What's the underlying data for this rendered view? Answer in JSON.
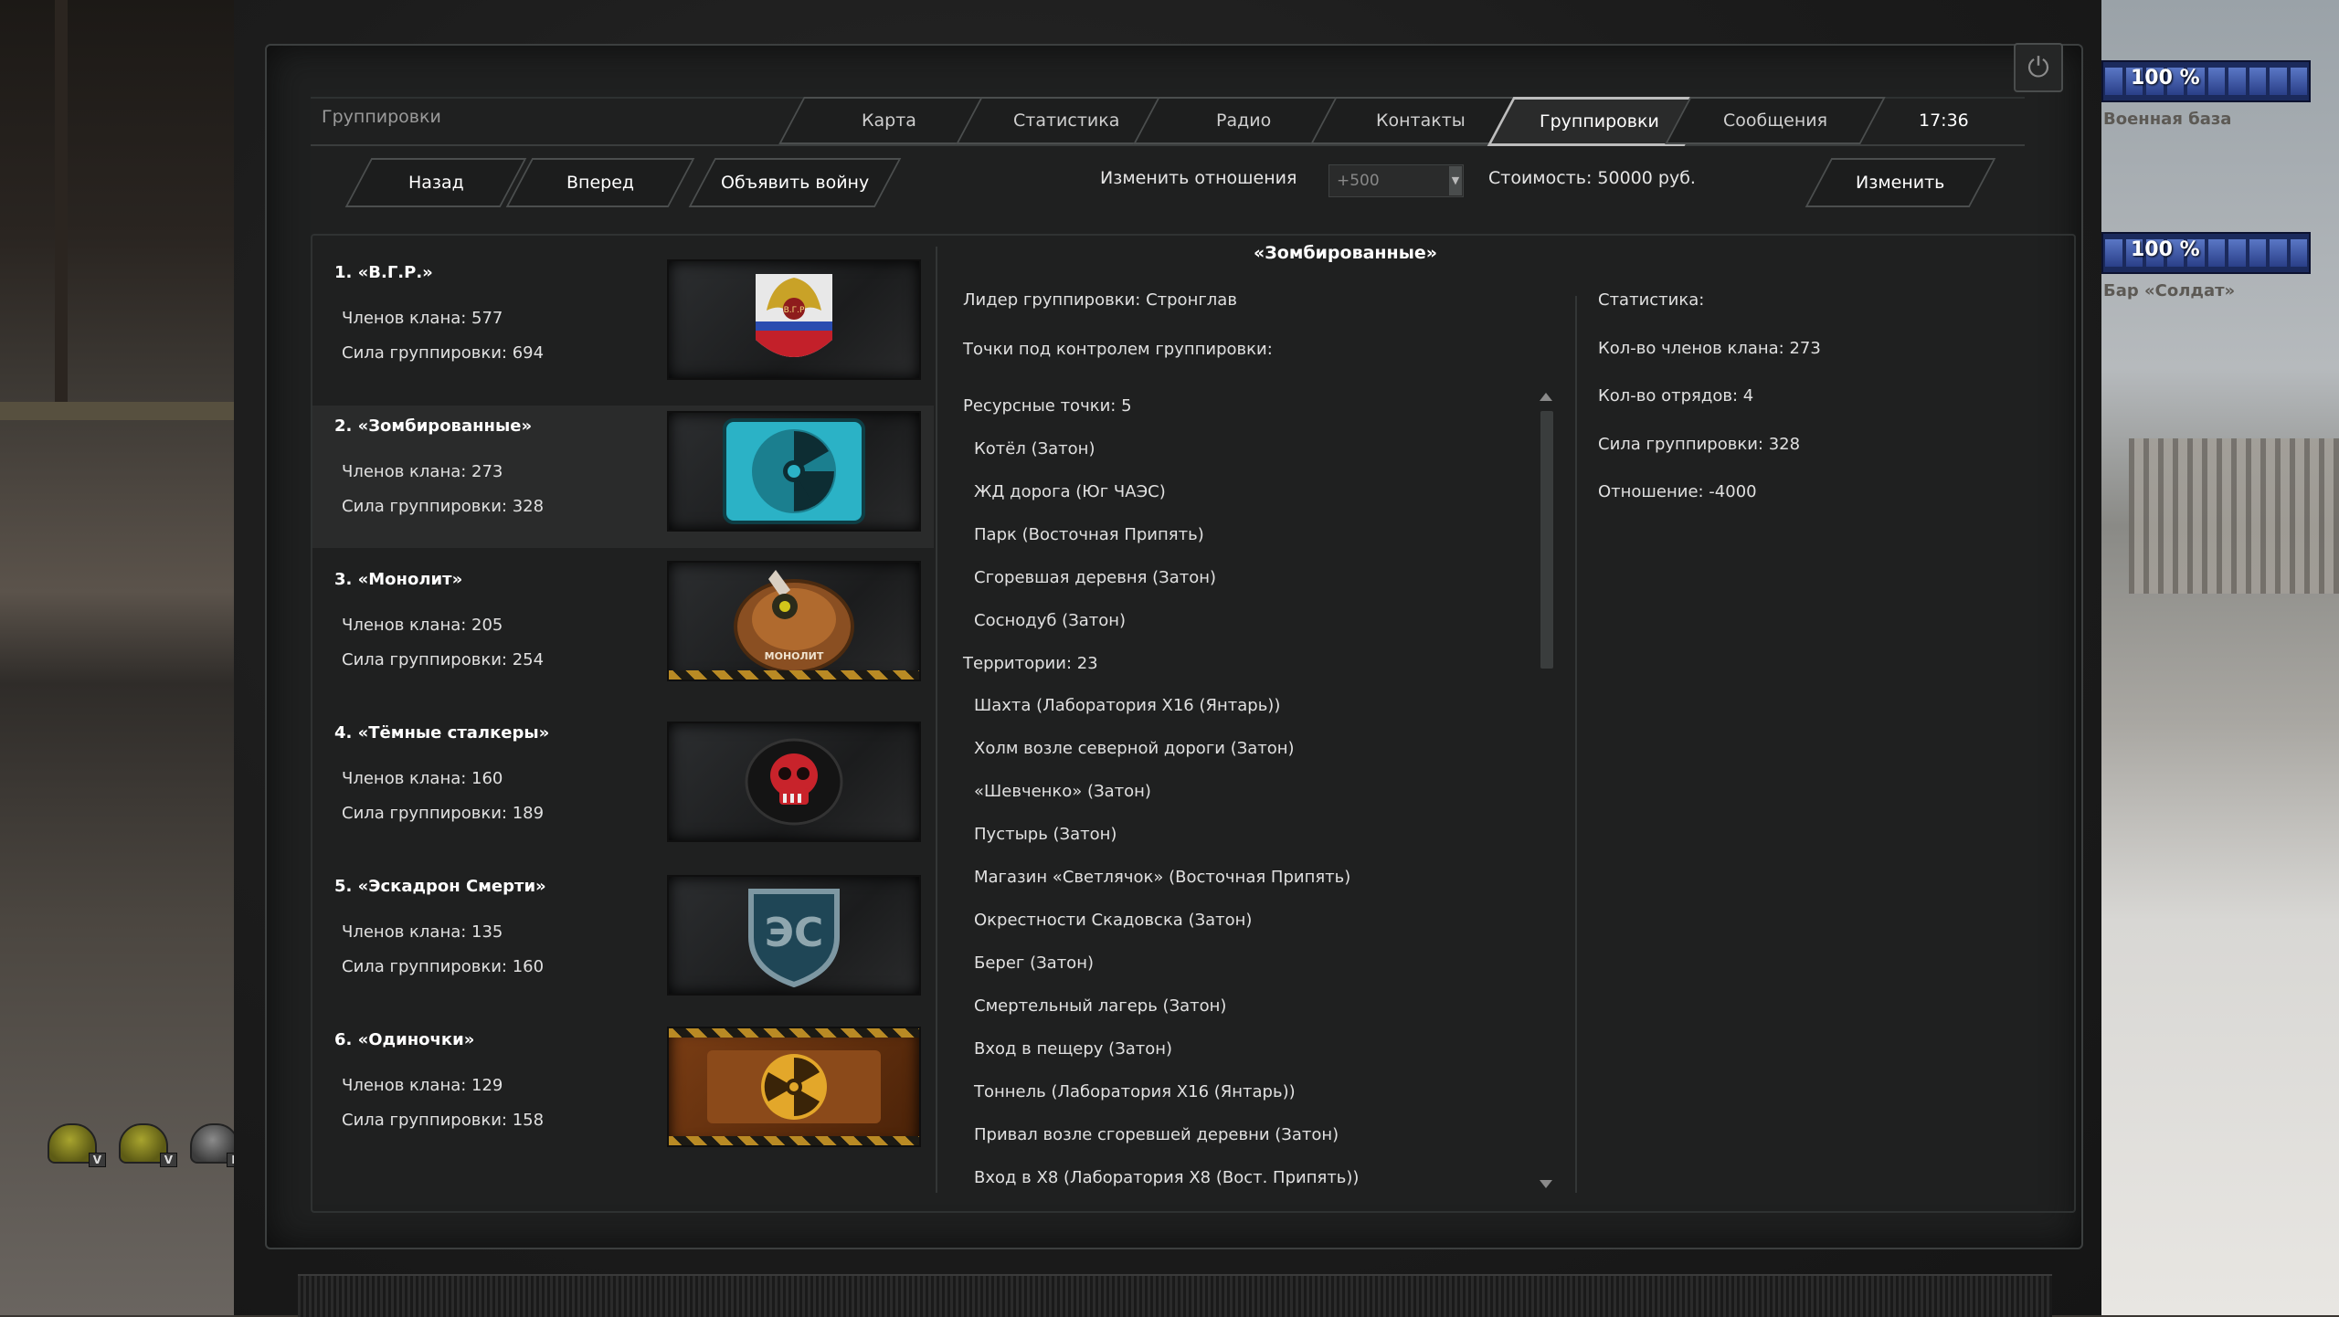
{
  "window": {
    "section_label": "Группировки",
    "clock": "17:36",
    "tabs": [
      {
        "label": "Карта"
      },
      {
        "label": "Статистика"
      },
      {
        "label": "Радио"
      },
      {
        "label": "Контакты"
      },
      {
        "label": "Группировки",
        "active": true
      },
      {
        "label": "Сообщения"
      }
    ]
  },
  "actions": {
    "back_label": "Назад",
    "forward_label": "Вперед",
    "declare_war_label": "Объявить войну",
    "change_relation_label": "Изменить отношения",
    "relation_placeholder": "+500",
    "cost_label": "Стоимость: 50000 руб.",
    "apply_label": "Изменить"
  },
  "factions": [
    {
      "name": "1. «В.Г.Р.»",
      "members": "Членов клана: 577",
      "power": "Сила группировки: 694",
      "emblem": "vgr-eagle-emblem"
    },
    {
      "name": "2. «Зомбированные»",
      "members": "Членов клана: 273",
      "power": "Сила группировки: 328",
      "emblem": "radiation-teal-emblem"
    },
    {
      "name": "3. «Монолит»",
      "members": "Членов клана: 205",
      "power": "Сила группировки: 254",
      "emblem": "monolith-emblem",
      "emblem_text": "МОНОЛИТ"
    },
    {
      "name": "4. «Тёмные сталкеры»",
      "members": "Членов клана: 160",
      "power": "Сила группировки: 189",
      "emblem": "red-skull-emblem"
    },
    {
      "name": "5. «Эскадрон Смерти»",
      "members": "Членов клана: 135",
      "power": "Сила группировки: 160",
      "emblem": "es-shield-emblem",
      "emblem_text": "ЭС"
    },
    {
      "name": "6. «Одиночки»",
      "members": "Членов клана: 129",
      "power": "Сила группировки: 158",
      "emblem": "radiation-yellow-emblem"
    }
  ],
  "detail": {
    "title": "«Зомбированные»",
    "leader": "Лидер группировки: Стронглав",
    "controlled_points": "Точки под контролем группировки:",
    "resource_points_header": "Ресурсные точки:  5",
    "resource_points": [
      "Котёл (Затон)",
      "ЖД дорога (Юг ЧАЭС)",
      "Парк (Восточная Припять)",
      "Сгоревшая деревня (Затон)",
      "Соснодуб (Затон)"
    ],
    "territories_header": "Территории:  23",
    "territories": [
      "Шахта (Лаборатория Х16 (Янтарь))",
      "Холм возле северной дороги (Затон)",
      "«Шевченко» (Затон)",
      "Пустырь (Затон)",
      "Магазин «Светлячок» (Восточная Припять)",
      "Окрестности Скадовска (Затон)",
      "Берег (Затон)",
      "Смертельный лагерь (Затон)",
      "Вход в пещеру (Затон)",
      "Тоннель (Лаборатория Х16 (Янтарь))",
      "Привал возле сгоревшей деревни (Затон)",
      "Вход в Х8 (Лаборатория Х8 (Вост. Припять))"
    ],
    "stats_header": "Статистика:",
    "stats": [
      "Кол-во членов клана: 273",
      "Кол-во отрядов: 4",
      "Сила группировки: 328",
      "Отношение: -4000"
    ]
  },
  "hud": {
    "bars": [
      {
        "percent_text": "100 %",
        "label": "Военная база",
        "fill": 1.0
      },
      {
        "percent_text": "100 %",
        "label": "Бар «Солдат»",
        "fill": 1.0
      }
    ],
    "helmets": [
      {
        "rank": "V",
        "color": "olive"
      },
      {
        "rank": "V",
        "color": "olive"
      },
      {
        "rank": "IV",
        "color": "gray"
      }
    ]
  }
}
